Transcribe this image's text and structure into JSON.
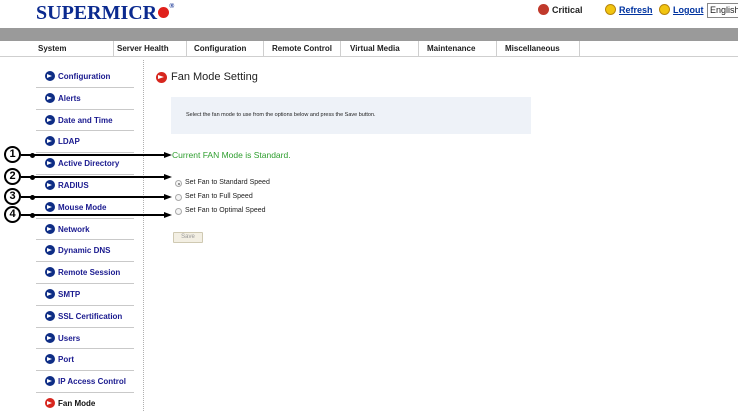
{
  "header": {
    "logo_text": "SUPERMICR",
    "logo_reg": "®",
    "critical_label": "Critical",
    "refresh_label": "Refresh",
    "logout_label": "Logout",
    "language_value": "English"
  },
  "nav": {
    "items": [
      "System",
      "Server Health",
      "Configuration",
      "Remote Control",
      "Virtual Media",
      "Maintenance",
      "Miscellaneous"
    ]
  },
  "sidebar": {
    "items": [
      {
        "label": "Configuration"
      },
      {
        "label": "Alerts"
      },
      {
        "label": "Date and Time"
      },
      {
        "label": "LDAP"
      },
      {
        "label": "Active Directory"
      },
      {
        "label": "RADIUS"
      },
      {
        "label": "Mouse Mode"
      },
      {
        "label": "Network"
      },
      {
        "label": "Dynamic DNS"
      },
      {
        "label": "Remote Session"
      },
      {
        "label": "SMTP"
      },
      {
        "label": "SSL Certification"
      },
      {
        "label": "Users"
      },
      {
        "label": "Port"
      },
      {
        "label": "IP Access Control"
      },
      {
        "label": "Fan Mode"
      }
    ],
    "active": "Fan Mode"
  },
  "main": {
    "title": "Fan Mode Setting",
    "info_text": "Select the fan mode to use from the options below and press the Save button.",
    "current_mode_text": "Current FAN Mode is Standard.",
    "options": [
      {
        "label": "Set Fan to Standard Speed",
        "checked": true
      },
      {
        "label": "Set Fan to Full Speed",
        "checked": false
      },
      {
        "label": "Set Fan to Optimal Speed",
        "checked": false
      }
    ],
    "save_label": "Save"
  },
  "callouts": [
    "1",
    "2",
    "3",
    "4"
  ]
}
